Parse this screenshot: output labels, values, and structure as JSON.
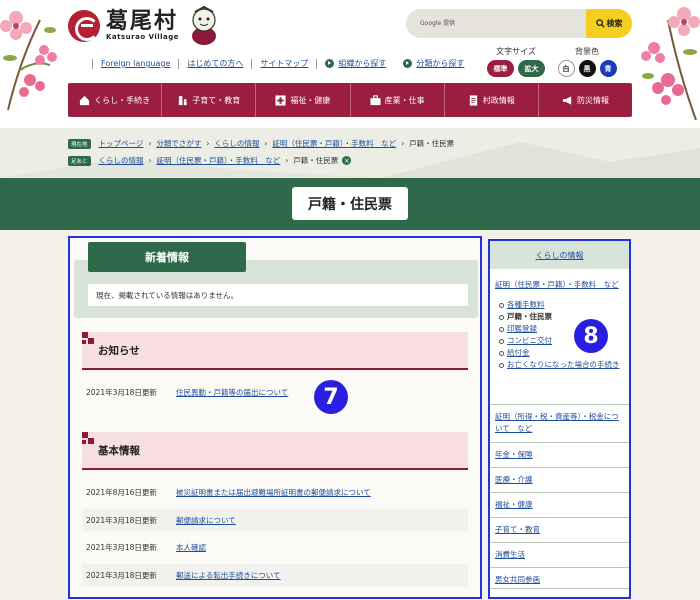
{
  "header": {
    "logo_title": "葛尾村",
    "logo_subtitle": "Katsurao Village",
    "search": {
      "placeholder": "Google 提供",
      "button_label": "検索"
    },
    "util_links": [
      "Foreign language",
      "はじめての方へ",
      "サイトマップ"
    ],
    "find_links": [
      "組織から探す",
      "分類から探す"
    ],
    "font_size": {
      "label": "文字サイズ",
      "options": [
        "標準",
        "拡大"
      ]
    },
    "bg_color": {
      "label": "背景色",
      "options": [
        "白",
        "黒",
        "青"
      ]
    },
    "colors": {
      "brand": "#9b1d3f",
      "green": "#2e6a49",
      "yellow": "#f5cf1f"
    }
  },
  "nav": [
    {
      "label": "くらし・手続き",
      "icon": "house-icon"
    },
    {
      "label": "子育て・教育",
      "icon": "family-icon"
    },
    {
      "label": "福祉・健康",
      "icon": "medical-cross-icon"
    },
    {
      "label": "産業・仕事",
      "icon": "briefcase-icon"
    },
    {
      "label": "村政情報",
      "icon": "document-icon"
    },
    {
      "label": "防災情報",
      "icon": "megaphone-icon"
    }
  ],
  "breadcrumbs": {
    "current_tag": "現在地",
    "current": [
      "トップページ",
      "分類でさがす",
      "くらしの情報",
      "証明（住民票・戸籍）・手数料　など",
      "戸籍・住民票"
    ],
    "history_tag": "足あと",
    "history": [
      "くらしの情報",
      "証明（住民票・戸籍）・手数料　など",
      "戸籍・住民票"
    ]
  },
  "page_title": "戸籍・住民票",
  "main": {
    "news": {
      "tab_label": "新着情報",
      "empty_message": "現在、掲載されている情報はありません。"
    },
    "notice": {
      "heading": "お知らせ",
      "items": [
        {
          "date": "2021年3月18日更新",
          "title": "住民異動・戸籍等の届出について"
        }
      ]
    },
    "basic": {
      "heading": "基本情報",
      "items": [
        {
          "date": "2021年8月16日更新",
          "title": "被災証明書または届出避難場所証明書の郵便請求について"
        },
        {
          "date": "2021年3月18日更新",
          "title": "郵便請求について"
        },
        {
          "date": "2021年3月18日更新",
          "title": "本人確認"
        },
        {
          "date": "2021年3月18日更新",
          "title": "郵送による転出手続きについて"
        }
      ]
    },
    "badge": "7"
  },
  "sidebar": {
    "heading": "くらしの情報",
    "top_link": "証明（住民票・戸籍）・手数料　など",
    "sub_items": [
      {
        "label": "各種手数料",
        "current": false
      },
      {
        "label": "戸籍・住民票",
        "current": true
      },
      {
        "label": "印鑑登録",
        "current": false
      },
      {
        "label": "コンビニ交付",
        "current": false
      },
      {
        "label": "給付金",
        "current": false
      },
      {
        "label": "お亡くなりになった場合の手続き",
        "current": false
      }
    ],
    "items": [
      "証明（所得・税・資産等）・税金について　など",
      "年金・保険",
      "医療・介護",
      "福祉・健康",
      "子育て・教育",
      "消費生活",
      "男女共同参画"
    ],
    "badge": "8"
  }
}
